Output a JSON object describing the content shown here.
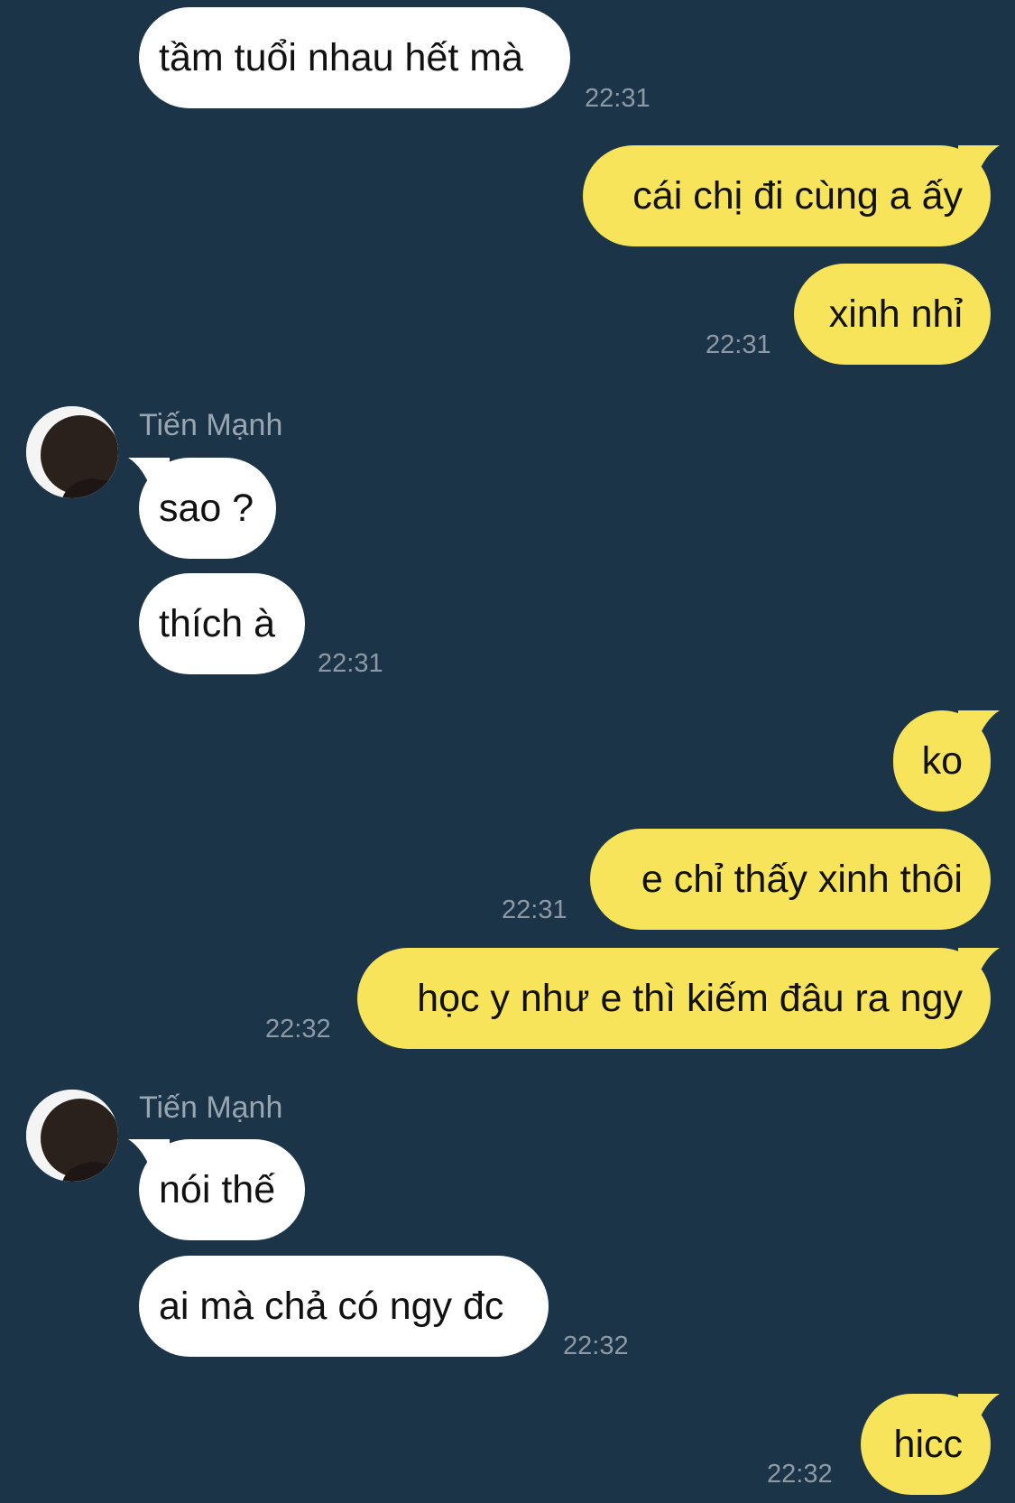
{
  "conversation": {
    "messages": [
      {
        "direction": "in",
        "text": "tầm tuổi nhau hết mà",
        "time": "22:31"
      },
      {
        "direction": "out",
        "text": "cái chị đi cùng a ấy"
      },
      {
        "direction": "out",
        "text": "xinh nhỉ",
        "time": "22:31"
      },
      {
        "direction": "in",
        "sender": "Tiến Mạnh",
        "text": "sao ?"
      },
      {
        "direction": "in",
        "text": "thích à",
        "time": "22:31"
      },
      {
        "direction": "out",
        "text": "ko"
      },
      {
        "direction": "out",
        "text": "e chỉ thấy xinh thôi",
        "time": "22:31"
      },
      {
        "direction": "out",
        "text": "học y như e thì kiếm đâu ra ngy",
        "time": "22:32"
      },
      {
        "direction": "in",
        "sender": "Tiến Mạnh",
        "text": "nói thế"
      },
      {
        "direction": "in",
        "text": "ai mà chả có ngy đc",
        "time": "22:32"
      },
      {
        "direction": "out",
        "text": "hicc",
        "time": "22:32"
      }
    ]
  },
  "colors": {
    "background": "#1c3448",
    "incoming_bubble": "#ffffff",
    "outgoing_bubble": "#f7e45a",
    "timestamp": "#8d9aa6",
    "sender_name": "#98a6b2"
  },
  "icons": {
    "avatar": "profile-photo-avatar"
  }
}
